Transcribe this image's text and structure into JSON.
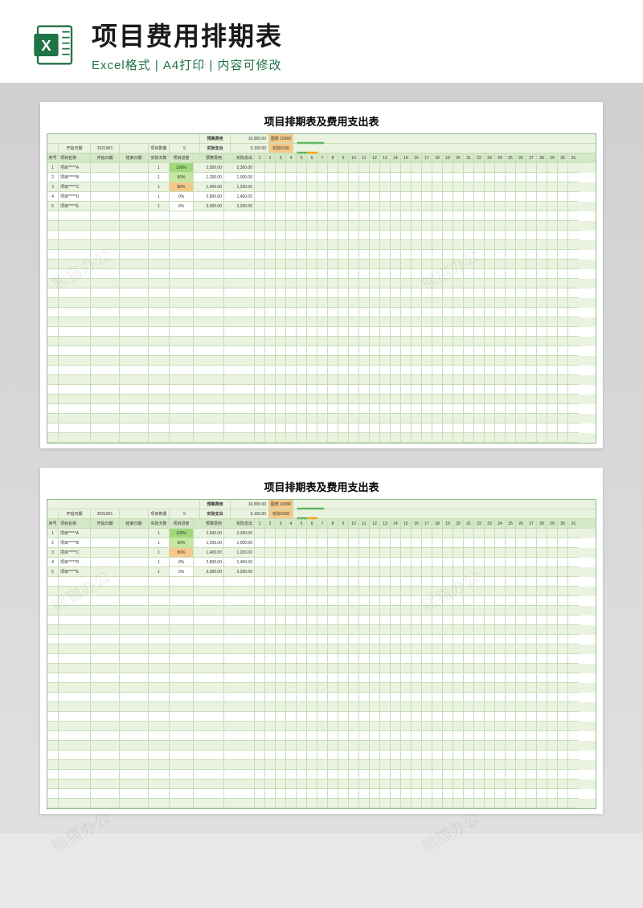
{
  "header": {
    "main_title": "项目费用排期表",
    "sub_title": "Excel格式 | A4打印 | 内容可修改",
    "icon_letter": "X"
  },
  "sheet": {
    "title": "项目排期表及费用支出表",
    "meta": {
      "start_date_label": "开始日期",
      "start_date_value": "2021/8/1",
      "count_label": "项目数量",
      "count_value": "5",
      "budget_label": "预算费用",
      "budget_value": "10,900.00",
      "budget_tag": "图表 10900",
      "actual_label": "实际支出",
      "actual_value": "9,100.00",
      "actual_tag": "实际9100"
    },
    "columns": {
      "seq": "序号",
      "name": "项目名称",
      "start": "开始日期",
      "end": "结束日期",
      "days": "实际天数",
      "prog": "项目进度",
      "budget": "预算费用",
      "actual": "实际支出"
    },
    "day_labels": [
      "1",
      "2",
      "3",
      "4",
      "5",
      "6",
      "7",
      "8",
      "9",
      "10",
      "11",
      "12",
      "13",
      "14",
      "15",
      "16",
      "17",
      "18",
      "19",
      "20",
      "21",
      "22",
      "23",
      "24",
      "25",
      "26",
      "27",
      "28",
      "29",
      "30",
      "31"
    ],
    "rows": [
      {
        "seq": "1",
        "name": "项目*****A",
        "days": "1",
        "prog": "100%",
        "prog_cls": "prog-100",
        "budget": "2,500.00",
        "actual": "2,300.00"
      },
      {
        "seq": "2",
        "name": "项目*****B",
        "days": "1",
        "prog": "90%",
        "prog_cls": "prog-90",
        "budget": "1,200.00",
        "actual": "1,000.00"
      },
      {
        "seq": "3",
        "name": "项目*****C",
        "days": "1",
        "prog": "80%",
        "prog_cls": "prog-80",
        "budget": "1,400.00",
        "actual": "1,200.00"
      },
      {
        "seq": "4",
        "name": "项目*****D",
        "days": "1",
        "prog": "0%",
        "prog_cls": "prog-0",
        "budget": "2,800.00",
        "actual": "1,400.00"
      },
      {
        "seq": "5",
        "name": "项目*****E",
        "days": "1",
        "prog": "0%",
        "prog_cls": "prog-0",
        "budget": "3,000.00",
        "actual": "3,200.00"
      }
    ],
    "hearts_budget": {
      "green": 13,
      "orange": 0
    },
    "hearts_actual": {
      "green": 5,
      "orange": 5
    }
  },
  "watermark": "熊猫办公"
}
